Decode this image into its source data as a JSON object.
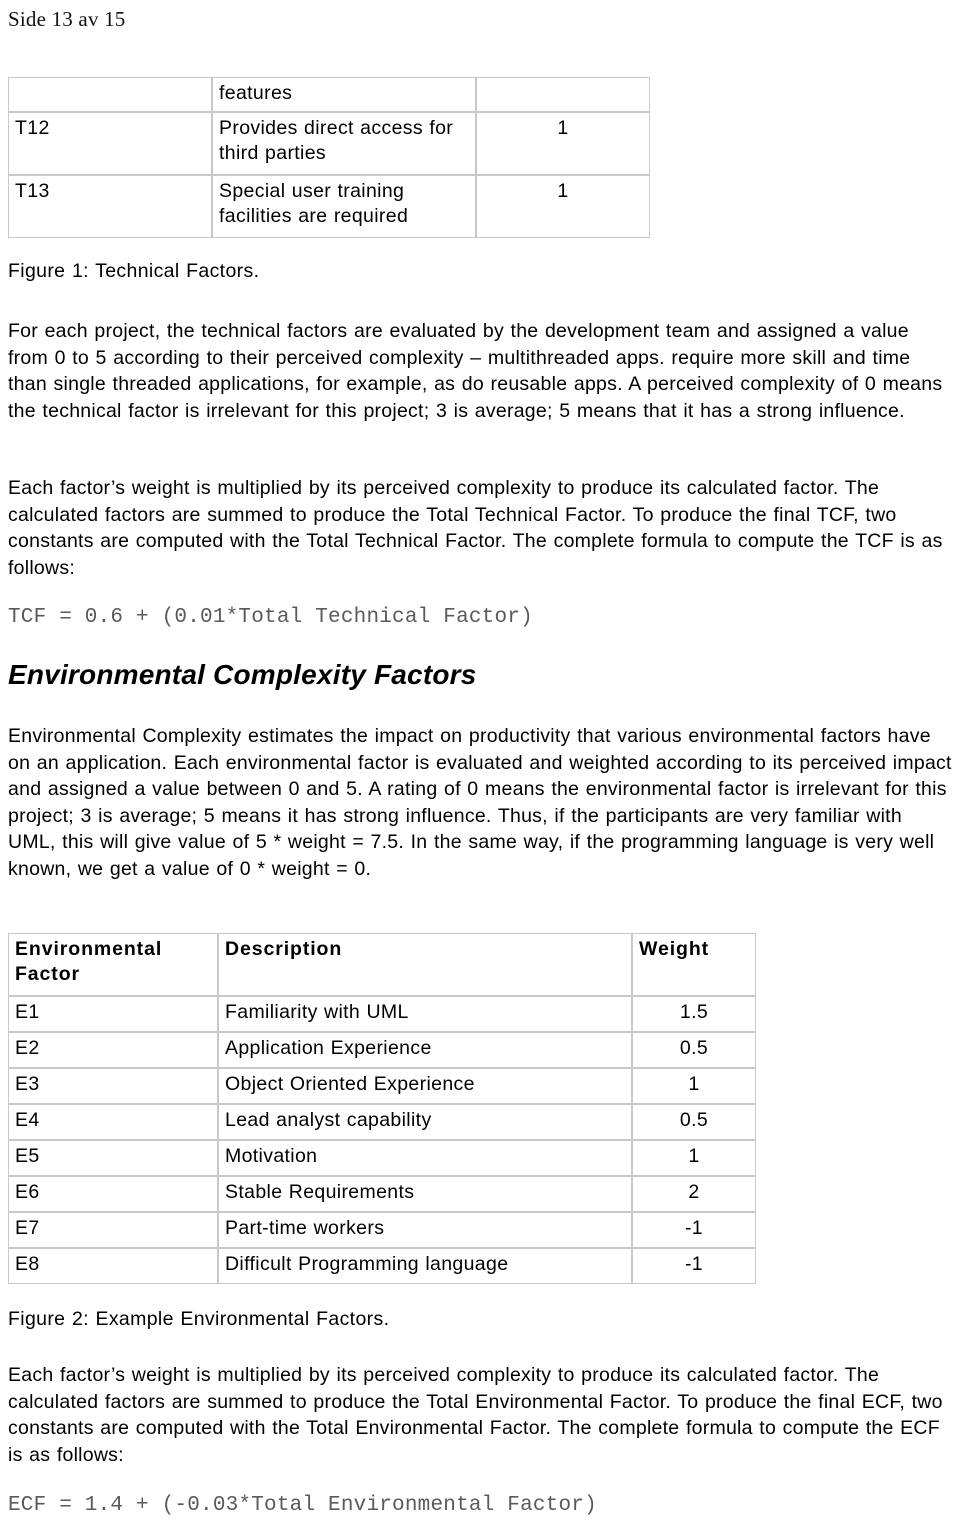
{
  "header": {
    "page_label": "Side 13 av 15"
  },
  "technical_table": {
    "columns": [
      "",
      "",
      ""
    ],
    "rows": [
      {
        "id": "",
        "description": "features",
        "weight": ""
      },
      {
        "id": "T12",
        "description": "Provides direct access for third parties",
        "weight": "1"
      },
      {
        "id": "T13",
        "description": "Special user training facilities are required",
        "weight": "1"
      }
    ]
  },
  "figure1_caption": "Figure 1: Technical Factors.",
  "paragraph_technical": "For each project, the technical factors are evaluated by the development team and assigned a value from 0 to 5 according to their perceived complexity – multithreaded apps. require more skill and time than single threaded applications, for example, as do reusable apps. A perceived complexity of 0 means the technical factor is irrelevant for this project; 3 is average; 5 means that it has a strong influence.",
  "paragraph_weight_tcf": "Each factor’s weight is multiplied by its perceived complexity to produce its calculated factor. The calculated factors are summed to produce the Total Technical Factor. To produce the final TCF, two constants are computed with the Total Technical Factor. The complete formula to compute the TCF is as follows:",
  "formula_tcf": "TCF = 0.6 + (0.01*Total Technical Factor)",
  "section_heading_env": "Environmental Complexity Factors",
  "paragraph_environmental": "Environmental Complexity estimates the impact on productivity that various environmental factors have on an application. Each environmental factor is evaluated and weighted according to its perceived impact and assigned a value between 0 and 5. A rating of 0 means the environmental factor is irrelevant for this project; 3 is average; 5 means it has strong influence. Thus, if the participants are very familiar with UML, this will give value of 5 * weight = 7.5. In the same way, if the programming language is very well known, we get a value of 0 * weight = 0.",
  "environmental_table": {
    "headers": {
      "factor": "Environmental Factor",
      "description": "Description",
      "weight": "Weight"
    },
    "rows": [
      {
        "id": "E1",
        "description": "Familiarity with UML",
        "weight": "1.5"
      },
      {
        "id": "E2",
        "description": "Application Experience",
        "weight": "0.5"
      },
      {
        "id": "E3",
        "description": "Object Oriented Experience",
        "weight": "1"
      },
      {
        "id": "E4",
        "description": "Lead analyst capability",
        "weight": "0.5"
      },
      {
        "id": "E5",
        "description": "Motivation",
        "weight": "1"
      },
      {
        "id": "E6",
        "description": "Stable Requirements",
        "weight": "2"
      },
      {
        "id": "E7",
        "description": "Part-time workers",
        "weight": "-1"
      },
      {
        "id": "E8",
        "description": "Difficult Programming language",
        "weight": "-1"
      }
    ]
  },
  "figure2_caption": "Figure 2: Example Environmental Factors.",
  "paragraph_weight_ecf": "Each factor’s weight is multiplied by its perceived complexity to produce its calculated factor. The calculated factors are summed to produce the Total Environmental Factor. To produce the final ECF, two constants are computed with the Total Environmental Factor. The complete formula to compute the ECF is as follows:",
  "formula_ecf": "ECF = 1.4 + (-0.03*Total Environmental Factor)",
  "colors": {
    "text": "#000000",
    "formula_text": "#5a5a5a",
    "table_border": "#c9c9c9",
    "background": "#ffffff"
  }
}
